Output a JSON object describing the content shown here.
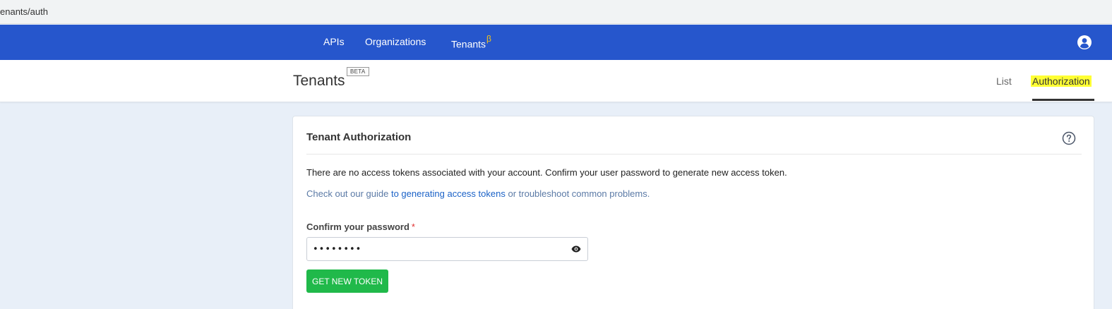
{
  "browser": {
    "url": "enants/auth"
  },
  "nav": {
    "items": [
      {
        "label": "APIs"
      },
      {
        "label": "Organizations"
      },
      {
        "label": "Tenants",
        "superscript": "β"
      }
    ],
    "profile_icon": "user-circle-icon",
    "colors": {
      "bar": "#2656cc",
      "superscript": "#f5c518"
    }
  },
  "subheader": {
    "title": "Tenants",
    "badge": "BETA",
    "tabs": [
      {
        "label": "List",
        "active": false
      },
      {
        "label": "Authorization",
        "active": true,
        "highlighted": true
      }
    ],
    "colors": {
      "highlight": "#ffff33"
    }
  },
  "card": {
    "title": "Tenant Authorization",
    "help_icon": "question-circle-icon",
    "message": "There are no access tokens associated with your account. Confirm your user password to generate new access token.",
    "guide": {
      "prefix": "Check out our guide ",
      "link": "to generating access tokens",
      "suffix": " or troubleshoot common problems."
    },
    "password": {
      "label": "Confirm your password",
      "required_mark": "*",
      "value": "••••••••",
      "eye_icon": "eye-icon"
    },
    "button": {
      "label": "GET NEW TOKEN",
      "color": "#20b94a"
    }
  }
}
